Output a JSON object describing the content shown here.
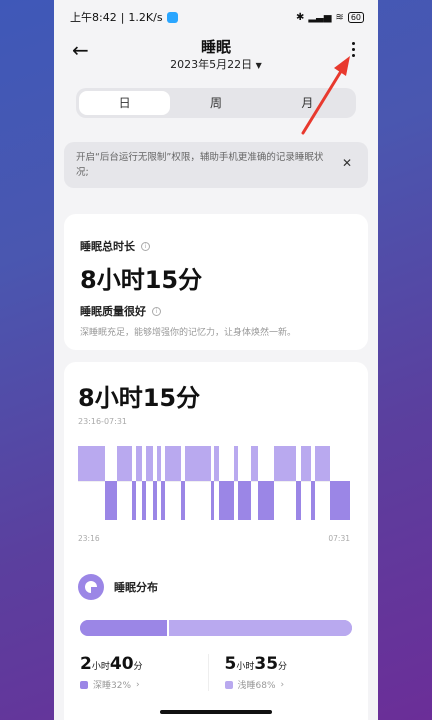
{
  "status": {
    "time": "上午8:42",
    "speed": "1.2K/s",
    "battery": "60"
  },
  "header": {
    "title": "睡眠",
    "date": "2023年5月22日"
  },
  "tabs": [
    {
      "label": "日"
    },
    {
      "label": "周"
    },
    {
      "label": "月"
    }
  ],
  "notice": {
    "text": "开启“后台运行无限制”权限，辅助手机更准确的记录睡眠状况;"
  },
  "summary": {
    "total_label": "睡眠总时长",
    "total_value": "8小时15分",
    "quality_label": "睡眠质量很好",
    "quality_desc": "深睡眠充足，能够增强你的记忆力，让身体焕然一新。"
  },
  "stage_chart": {
    "duration": "8小时15分",
    "range": "23:16-07:31",
    "start_label": "23:16",
    "end_label": "07:31"
  },
  "chart_data": {
    "type": "bar",
    "title": "8小时15分",
    "xlabel": "",
    "ylabel": "",
    "x_start": "23:16",
    "x_end": "07:31",
    "levels": [
      "浅睡",
      "深睡"
    ],
    "segments": [
      {
        "stage": "浅睡",
        "start": 0.0,
        "end": 0.1
      },
      {
        "stage": "深睡",
        "start": 0.1,
        "end": 0.145
      },
      {
        "stage": "浅睡",
        "start": 0.145,
        "end": 0.2
      },
      {
        "stage": "深睡",
        "start": 0.2,
        "end": 0.215
      },
      {
        "stage": "浅睡",
        "start": 0.215,
        "end": 0.235
      },
      {
        "stage": "深睡",
        "start": 0.235,
        "end": 0.25
      },
      {
        "stage": "浅睡",
        "start": 0.25,
        "end": 0.275
      },
      {
        "stage": "深睡",
        "start": 0.275,
        "end": 0.29
      },
      {
        "stage": "浅睡",
        "start": 0.29,
        "end": 0.305
      },
      {
        "stage": "深睡",
        "start": 0.305,
        "end": 0.32
      },
      {
        "stage": "浅睡",
        "start": 0.32,
        "end": 0.38
      },
      {
        "stage": "深睡",
        "start": 0.38,
        "end": 0.395
      },
      {
        "stage": "浅睡",
        "start": 0.395,
        "end": 0.49
      },
      {
        "stage": "深睡",
        "start": 0.49,
        "end": 0.5
      },
      {
        "stage": "浅睡",
        "start": 0.5,
        "end": 0.52
      },
      {
        "stage": "深睡",
        "start": 0.52,
        "end": 0.575
      },
      {
        "stage": "浅睡",
        "start": 0.575,
        "end": 0.59
      },
      {
        "stage": "深睡",
        "start": 0.59,
        "end": 0.635
      },
      {
        "stage": "浅睡",
        "start": 0.635,
        "end": 0.66
      },
      {
        "stage": "深睡",
        "start": 0.66,
        "end": 0.72
      },
      {
        "stage": "浅睡",
        "start": 0.72,
        "end": 0.8
      },
      {
        "stage": "深睡",
        "start": 0.8,
        "end": 0.82
      },
      {
        "stage": "浅睡",
        "start": 0.82,
        "end": 0.855
      },
      {
        "stage": "深睡",
        "start": 0.855,
        "end": 0.87
      },
      {
        "stage": "浅睡",
        "start": 0.87,
        "end": 0.925
      },
      {
        "stage": "深睡",
        "start": 0.925,
        "end": 1.0
      }
    ],
    "deep_percent": 32,
    "light_percent": 68
  },
  "distribution": {
    "title": "睡眠分布",
    "deep_hours": "2",
    "deep_minutes": "40",
    "deep_label": "深睡32%",
    "light_hours": "5",
    "light_minutes": "35",
    "light_label": "浅睡68%",
    "hour_unit": "小时",
    "minute_unit": "分"
  },
  "colors": {
    "deep": "#9b86e6",
    "light": "#b9a9ef",
    "arrow": "#e8392e"
  },
  "icons": {
    "back": "back-arrow-icon",
    "more": "more-vertical-icon",
    "close": "close-icon",
    "info": "info-icon",
    "dropdown": "caret-down-icon"
  }
}
